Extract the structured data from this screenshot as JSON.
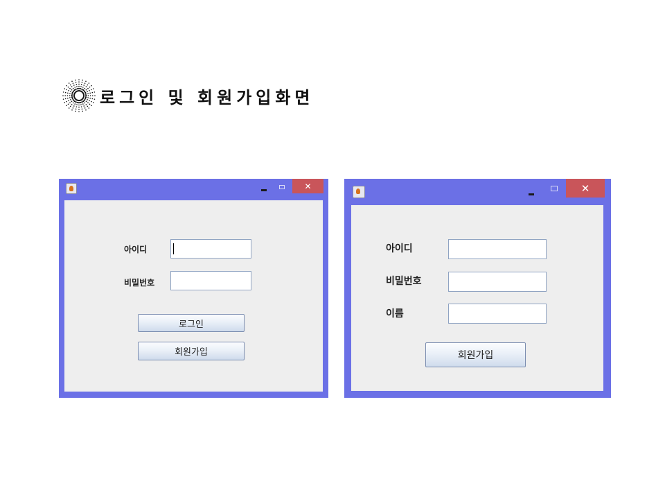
{
  "slide": {
    "title": "로그인 및 회원가입화면"
  },
  "login_window": {
    "min_glyph": "–",
    "close_glyph": "✕",
    "id_label": "아이디",
    "id_value": "",
    "pw_label": "비밀번호",
    "pw_value": "",
    "login_button": "로그인",
    "signup_button": "회원가입"
  },
  "signup_window": {
    "close_glyph": "✕",
    "id_label": "아이디",
    "id_value": "",
    "pw_label": "비밀번호",
    "pw_value": "",
    "name_label": "이름",
    "name_value": "",
    "signup_button": "회원가입"
  },
  "colors": {
    "window_frame": "#6b70e6",
    "close_button": "#c9555a",
    "content_bg": "#eeeeee"
  },
  "icons": [
    "starburst-icon",
    "java-app-icon",
    "minimize-icon",
    "maximize-icon",
    "close-icon"
  ]
}
